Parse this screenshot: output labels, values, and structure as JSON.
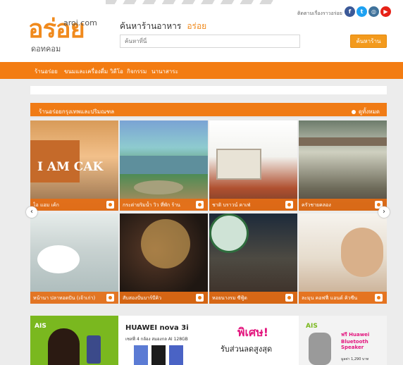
{
  "header": {
    "logo_main": "อร่อย",
    "logo_domain": "aroi.com",
    "logo_sub": "ดอทคอม",
    "search_title": "ค้นหาร้านอาหาร",
    "search_highlight": "อร่อย",
    "search_placeholder": "ค้นหาที่นี่",
    "search_button": "ค้นหาร้าน",
    "follow_text": "ติดตามเรื่องราวอร่อย",
    "socials": [
      {
        "name": "facebook-icon",
        "glyph": "f",
        "color": "#3b5998"
      },
      {
        "name": "twitter-icon",
        "glyph": "t",
        "color": "#1da1f2"
      },
      {
        "name": "instagram-icon",
        "glyph": "◎",
        "color": "#3f729b"
      },
      {
        "name": "youtube-icon",
        "glyph": "▶",
        "color": "#e62117"
      }
    ]
  },
  "nav": {
    "items": [
      "ร้านอร่อย",
      "ขนมและเครื่องดื่ม",
      "วิดีโอ",
      "กิจกรรม",
      "นานาสาระ"
    ]
  },
  "section": {
    "title": "ร้านอร่อยกรุงเทพและปริมณฑล",
    "more": "ดูทั้งหมด"
  },
  "tiles": [
    {
      "caption": "ไอ แอม เค้ก"
    },
    {
      "caption": "กระต่ายริมน้ำ วิว ที่พัก ร้าน"
    },
    {
      "caption": "ชาติ บราวน์ คาเฟ่"
    },
    {
      "caption": "ครัวชายคลอง"
    },
    {
      "caption": "หน้านา ปลาทอดปัน (เจ้าเก่า)"
    },
    {
      "caption": "สับสองปั่นบาร์บีคิว"
    },
    {
      "caption": "หอยนางรม ซีฟู้ด"
    },
    {
      "caption": "ละมุน คอฟฟี่ แอนด์ คิวซีน"
    }
  ],
  "ads": [
    {
      "brand": "AIS",
      "tag": "",
      "headline": "",
      "sub": ""
    },
    {
      "brand": "",
      "tag": "",
      "headline": "HUAWEI nova 3i",
      "sub": "เซลฟี่ 4 กล้อง สมองกล AI 128GB"
    },
    {
      "brand": "",
      "tag": "",
      "headline": "พิเศษ!",
      "sub": "รับส่วนลดสูงสุด"
    },
    {
      "brand": "AIS",
      "tag": "ฟรี Huawei Bluetooth Speaker",
      "headline": "",
      "sub": "มูลค่า 1,290 บาท"
    }
  ],
  "carousel": {
    "prev": "‹",
    "next": "›"
  }
}
